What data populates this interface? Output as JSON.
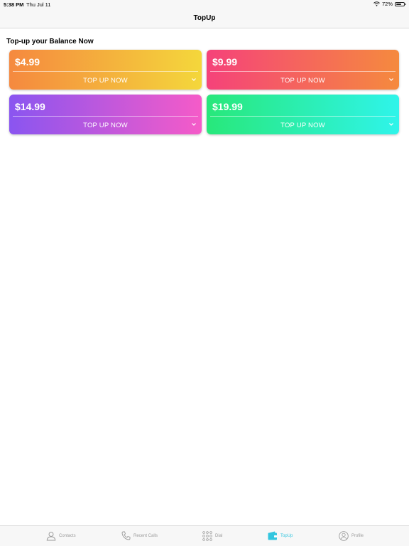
{
  "status": {
    "time": "5:38 PM",
    "date": "Thu Jul 11",
    "battery": "72%",
    "battery_level": 0.72
  },
  "nav": {
    "title": "TopUp"
  },
  "section_title": "Top-up your Balance Now",
  "cards": [
    {
      "price": "$4.99",
      "action": "TOP UP NOW",
      "colors": [
        "#f5893f",
        "#f4d73b"
      ]
    },
    {
      "price": "$9.99",
      "action": "TOP UP NOW",
      "colors": [
        "#f5427a",
        "#f58a3e"
      ]
    },
    {
      "price": "$14.99",
      "action": "TOP UP NOW",
      "colors": [
        "#8a55f0",
        "#f55bc8"
      ]
    },
    {
      "price": "$19.99",
      "action": "TOP UP NOW",
      "colors": [
        "#28e87a",
        "#2ff4ea"
      ]
    }
  ],
  "tabs": [
    {
      "label": "Contacts",
      "icon": "person-icon"
    },
    {
      "label": "Recent Calls",
      "icon": "phone-icon"
    },
    {
      "label": "Dial",
      "icon": "keypad-icon"
    },
    {
      "label": "TopUp",
      "icon": "wallet-icon",
      "active": true
    },
    {
      "label": "Profile",
      "icon": "profile-icon"
    }
  ],
  "colors": {
    "accent": "#34c6df",
    "inactive": "#9a9a9a"
  }
}
